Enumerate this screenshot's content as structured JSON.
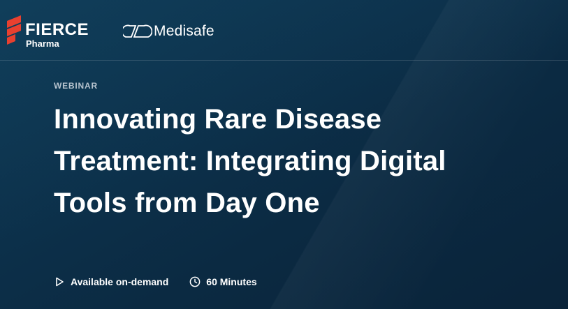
{
  "header": {
    "fierce_logo": {
      "word": "FIERCE",
      "sub": "Pharma",
      "mark_color": "#e8402f"
    },
    "partner_logo": {
      "word": "Medisafe"
    }
  },
  "hero": {
    "eyebrow": "WEBINAR",
    "title": "Innovating Rare Disease Treatment: Integrating Digital Tools from Day One"
  },
  "meta": {
    "availability": {
      "icon": "play-icon",
      "label": "Available on-demand"
    },
    "duration": {
      "icon": "clock-icon",
      "label": "60 Minutes"
    }
  },
  "colors": {
    "background": "#0c304a",
    "accent": "#e8402f",
    "eyebrow": "#b7c4cf"
  }
}
